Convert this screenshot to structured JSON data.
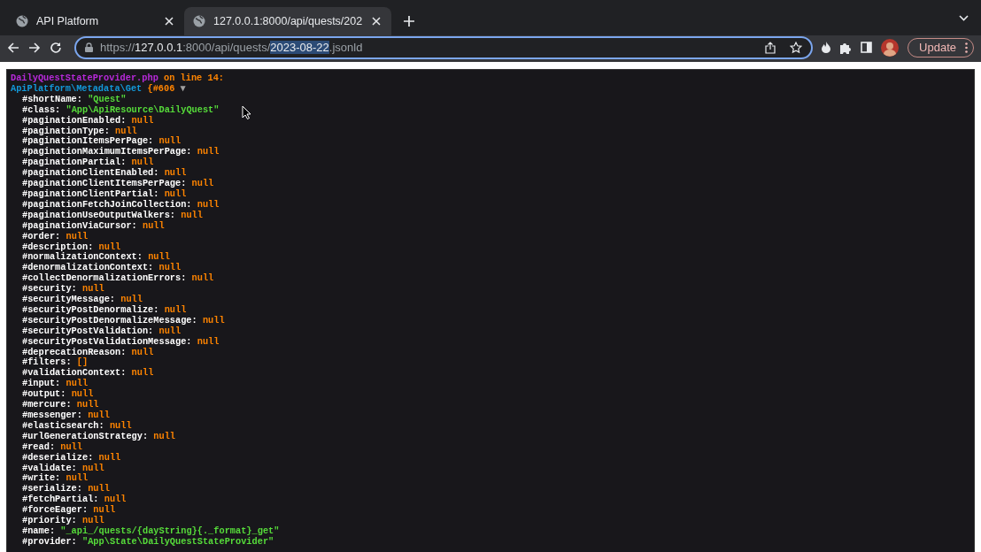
{
  "tabs": [
    {
      "title": "API Platform",
      "selected": false
    },
    {
      "title": "127.0.0.1:8000/api/quests/202",
      "selected": true
    }
  ],
  "address_bar": {
    "scheme": "https://",
    "host": "127.0.0.1",
    "path": ":8000/api/quests/",
    "selection": "2023-08-22",
    "suffix": ".jsonld"
  },
  "update_button": {
    "label": "Update"
  },
  "dump": {
    "file": "DailyQuestStateProvider.php",
    "location": "on line 14:",
    "class": "ApiPlatform\\Metadata\\Get",
    "object_id": "{#606",
    "toggle": "▼",
    "properties": [
      {
        "key": "#shortName:",
        "value": "\"Quest\"",
        "kind": "string"
      },
      {
        "key": "#class:",
        "value": "\"App\\ApiResource\\DailyQuest\"",
        "kind": "string"
      },
      {
        "key": "#paginationEnabled:",
        "value": "null",
        "kind": "null"
      },
      {
        "key": "#paginationType:",
        "value": "null",
        "kind": "null"
      },
      {
        "key": "#paginationItemsPerPage:",
        "value": "null",
        "kind": "null"
      },
      {
        "key": "#paginationMaximumItemsPerPage:",
        "value": "null",
        "kind": "null"
      },
      {
        "key": "#paginationPartial:",
        "value": "null",
        "kind": "null"
      },
      {
        "key": "#paginationClientEnabled:",
        "value": "null",
        "kind": "null"
      },
      {
        "key": "#paginationClientItemsPerPage:",
        "value": "null",
        "kind": "null"
      },
      {
        "key": "#paginationClientPartial:",
        "value": "null",
        "kind": "null"
      },
      {
        "key": "#paginationFetchJoinCollection:",
        "value": "null",
        "kind": "null"
      },
      {
        "key": "#paginationUseOutputWalkers:",
        "value": "null",
        "kind": "null"
      },
      {
        "key": "#paginationViaCursor:",
        "value": "null",
        "kind": "null"
      },
      {
        "key": "#order:",
        "value": "null",
        "kind": "null"
      },
      {
        "key": "#description:",
        "value": "null",
        "kind": "null"
      },
      {
        "key": "#normalizationContext:",
        "value": "null",
        "kind": "null"
      },
      {
        "key": "#denormalizationContext:",
        "value": "null",
        "kind": "null"
      },
      {
        "key": "#collectDenormalizationErrors:",
        "value": "null",
        "kind": "null"
      },
      {
        "key": "#security:",
        "value": "null",
        "kind": "null"
      },
      {
        "key": "#securityMessage:",
        "value": "null",
        "kind": "null"
      },
      {
        "key": "#securityPostDenormalize:",
        "value": "null",
        "kind": "null"
      },
      {
        "key": "#securityPostDenormalizeMessage:",
        "value": "null",
        "kind": "null"
      },
      {
        "key": "#securityPostValidation:",
        "value": "null",
        "kind": "null"
      },
      {
        "key": "#securityPostValidationMessage:",
        "value": "null",
        "kind": "null"
      },
      {
        "key": "#deprecationReason:",
        "value": "null",
        "kind": "null"
      },
      {
        "key": "#filters:",
        "value": "[]",
        "kind": "array"
      },
      {
        "key": "#validationContext:",
        "value": "null",
        "kind": "null"
      },
      {
        "key": "#input:",
        "value": "null",
        "kind": "null"
      },
      {
        "key": "#output:",
        "value": "null",
        "kind": "null"
      },
      {
        "key": "#mercure:",
        "value": "null",
        "kind": "null"
      },
      {
        "key": "#messenger:",
        "value": "null",
        "kind": "null"
      },
      {
        "key": "#elasticsearch:",
        "value": "null",
        "kind": "null"
      },
      {
        "key": "#urlGenerationStrategy:",
        "value": "null",
        "kind": "null"
      },
      {
        "key": "#read:",
        "value": "null",
        "kind": "null"
      },
      {
        "key": "#deserialize:",
        "value": "null",
        "kind": "null"
      },
      {
        "key": "#validate:",
        "value": "null",
        "kind": "null"
      },
      {
        "key": "#write:",
        "value": "null",
        "kind": "null"
      },
      {
        "key": "#serialize:",
        "value": "null",
        "kind": "null"
      },
      {
        "key": "#fetchPartial:",
        "value": "null",
        "kind": "null"
      },
      {
        "key": "#forceEager:",
        "value": "null",
        "kind": "null"
      },
      {
        "key": "#priority:",
        "value": "null",
        "kind": "null"
      },
      {
        "key": "#name:",
        "value": "\"_api_/quests/{dayString}{._format}_get\"",
        "kind": "string"
      },
      {
        "key": "#provider:",
        "value": "\"App\\State\\DailyQuestStateProvider\"",
        "kind": "string"
      }
    ]
  }
}
